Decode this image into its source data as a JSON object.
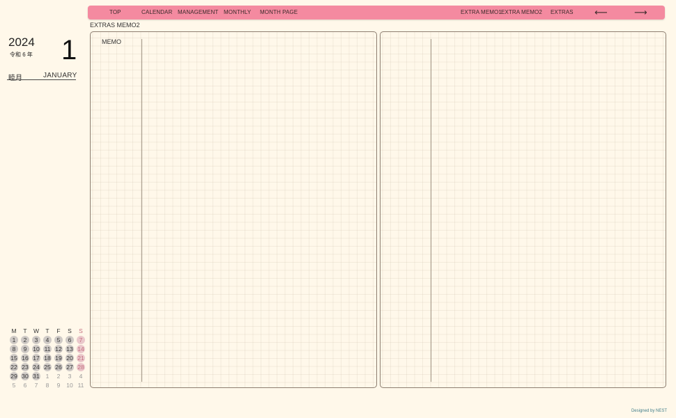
{
  "nav": {
    "items": [
      "TOP",
      "CALENDAR",
      "MANAGEMENT",
      "MONTHLY",
      "MONTH PAGE",
      "EXTRA MEMO1",
      "EXTRA MEMO2",
      "EXTRAS"
    ],
    "prev_arrow": "⟵",
    "next_arrow": "⟶"
  },
  "page_label": "EXTRAS MEMO2",
  "date": {
    "year": "2024",
    "era": "令和 6 年",
    "month_number": "1",
    "month_jp": "睦月",
    "month_en": "JANUARY"
  },
  "memo_label": "MEMO",
  "mini_calendar": {
    "weekdays": [
      "M",
      "T",
      "W",
      "T",
      "F",
      "S",
      "S"
    ],
    "weeks": [
      [
        "1",
        "2",
        "3",
        "4",
        "5",
        "6",
        "7"
      ],
      [
        "8",
        "9",
        "10",
        "11",
        "12",
        "13",
        "14"
      ],
      [
        "15",
        "16",
        "17",
        "18",
        "19",
        "20",
        "21"
      ],
      [
        "22",
        "23",
        "24",
        "25",
        "26",
        "27",
        "28"
      ],
      [
        "29",
        "30",
        "31",
        "1",
        "2",
        "3",
        "4"
      ],
      [
        "5",
        "6",
        "7",
        "8",
        "9",
        "10",
        "11"
      ]
    ]
  },
  "footer": "Designed by NEST",
  "colors": {
    "nav_bg": "#f48aa0",
    "page_bg": "#fff8ea",
    "sunday": "#c47080"
  }
}
